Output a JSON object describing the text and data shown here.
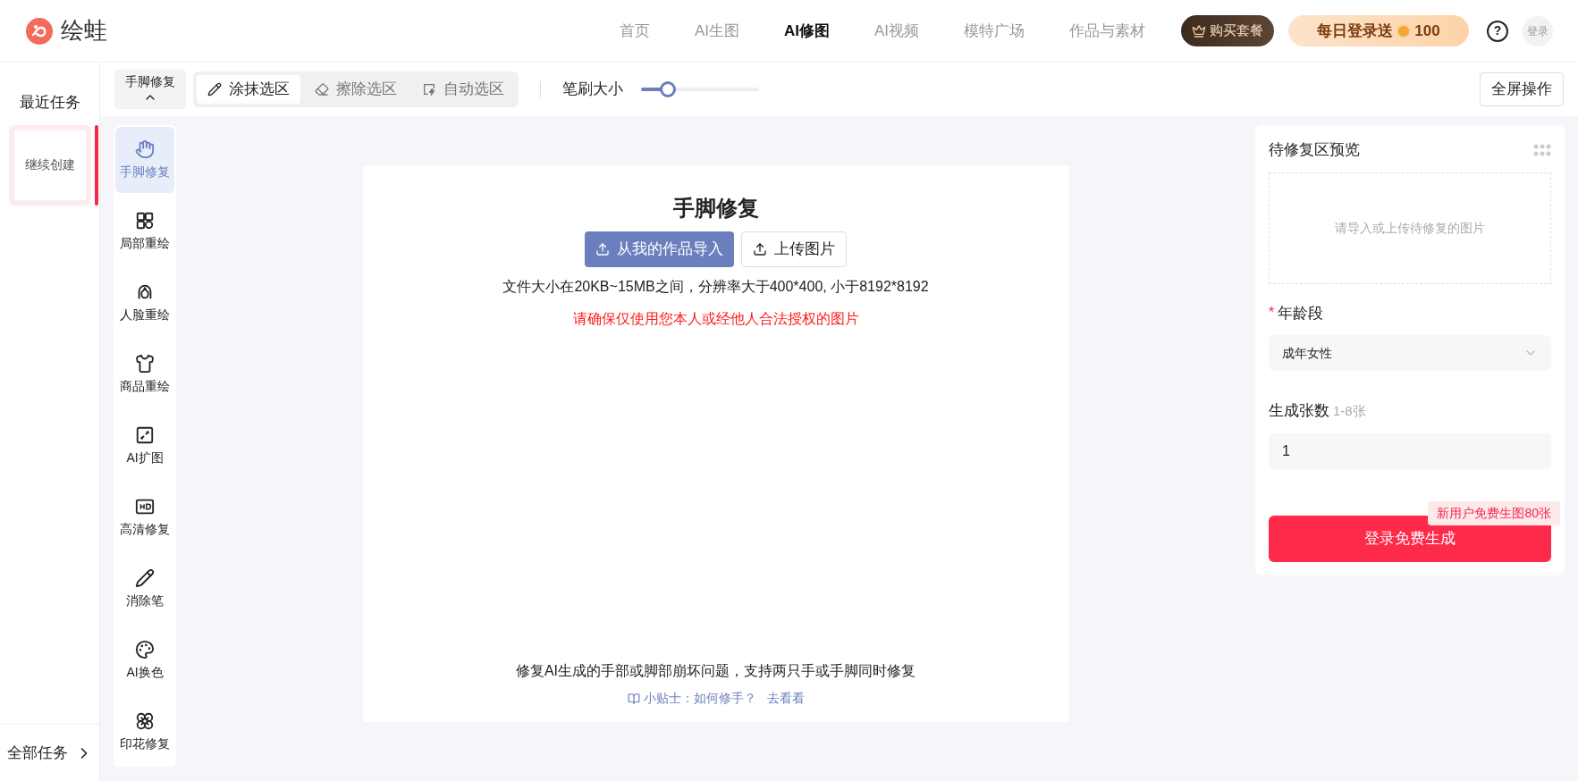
{
  "header": {
    "logo": "绘蛙",
    "nav": [
      {
        "label": "首页",
        "selected": false
      },
      {
        "label": "AI生图",
        "selected": false
      },
      {
        "label": "AI修图",
        "selected": true
      },
      {
        "label": "AI视频",
        "selected": false
      },
      {
        "label": "模特广场",
        "selected": false
      },
      {
        "label": "作品与素材",
        "selected": false
      }
    ],
    "buy_button": "购买套餐",
    "daily_bonus": {
      "label": "每日登录送",
      "count": "100"
    },
    "help": "?",
    "login": "登录"
  },
  "tasks": {
    "title": "最近任务",
    "items": [
      {
        "label": "继续创建",
        "selected": true
      }
    ],
    "all_link": "全部任务"
  },
  "toolbar": {
    "tool_menu": "手脚修复",
    "modes": [
      {
        "label": "涂抹选区",
        "selected": true
      },
      {
        "label": "擦除选区",
        "selected": false
      },
      {
        "label": "自动选区",
        "selected": false
      }
    ],
    "brush": {
      "label": "笔刷大小",
      "level": 0.23
    },
    "fullscreen": "全屏操作"
  },
  "tools": [
    {
      "label": "手脚修复",
      "selected": true
    },
    {
      "label": "局部重绘",
      "selected": false
    },
    {
      "label": "人脸重绘",
      "selected": false
    },
    {
      "label": "商品重绘",
      "selected": false
    },
    {
      "label": "AI扩图",
      "selected": false
    },
    {
      "label": "高清修复",
      "selected": false
    },
    {
      "label": "消除笔",
      "selected": false
    },
    {
      "label": "AI换色",
      "selected": false
    },
    {
      "label": "印花修复",
      "selected": false
    }
  ],
  "canvas": {
    "title": "手脚修复",
    "buttons": [
      {
        "label": "从我的作品导入",
        "primary": true
      },
      {
        "label": "上传图片",
        "primary": false
      }
    ],
    "file_note": "文件大小在20KB~15MB之间，分辨率大于400*400, 小于8192*8192",
    "warning": "请确保仅使用您本人或经他人合法授权的图片",
    "description": "修复AI生成的手部或脚部崩坏问题，支持两只手或手脚同时修复",
    "tip": {
      "label": "小贴士：如何修手？",
      "link": "去看看"
    }
  },
  "settings": {
    "preview_title": "待修复区预览",
    "preview_placeholder": "请导入或上传待修复的图片",
    "age": {
      "required_mark": "*",
      "label": "年龄段",
      "value": "成年女性"
    },
    "count": {
      "label": "生成张数",
      "hint": "1-8张",
      "value": "1"
    },
    "promo": "新用户免费生图80张",
    "submit": "登录免费生成"
  }
}
